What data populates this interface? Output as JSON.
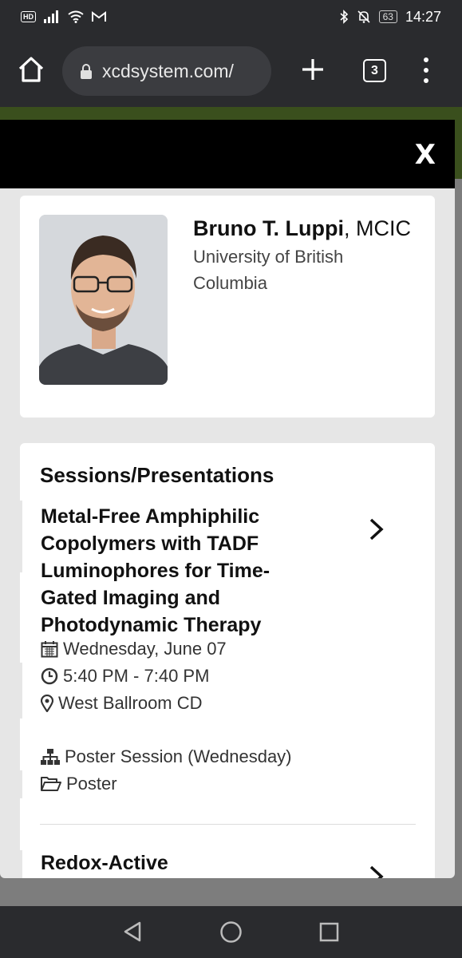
{
  "status_bar": {
    "hd": "HD",
    "battery": "63",
    "time": "14:27"
  },
  "browser": {
    "url": "xcdsystem.com/",
    "tab_count": "3"
  },
  "modal": {
    "close_label": "X",
    "profile": {
      "name": "Bruno T. Luppi",
      "credentials": ", MCIC",
      "affiliation": "University of British Columbia"
    },
    "sessions": {
      "heading": "Sessions/Presentations",
      "items": [
        {
          "title": "Metal-Free Amphiphilic Copolymers with TADF Luminophores for Time-Gated Imaging and Photodynamic Therapy",
          "date": "Wednesday, June 07",
          "time": "5:40 PM - 7:40 PM",
          "location": "West Ballroom CD",
          "session": "Poster Session (Wednesday)",
          "type": "Poster"
        },
        {
          "title": "Redox-Active"
        }
      ]
    }
  },
  "colors": {
    "site_green": "#3a4f1d",
    "modal_header": "#000000",
    "modal_bg": "#e6e6e6",
    "system_bar": "#2a2b2e"
  }
}
